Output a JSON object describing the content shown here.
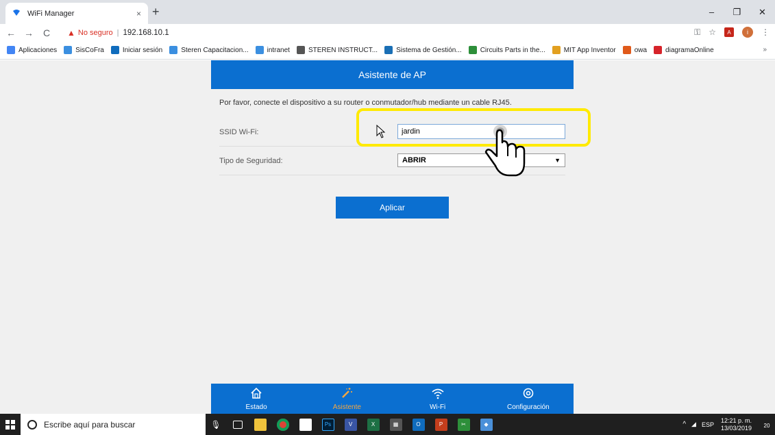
{
  "browser": {
    "tab_title": "WiFi Manager",
    "tab_close": "×",
    "new_tab": "+",
    "window_controls": {
      "minimize": "–",
      "restore": "❐",
      "close": "✕"
    },
    "nav": {
      "back": "←",
      "forward": "→",
      "reload": "C"
    },
    "not_secure": "No seguro",
    "separator": "|",
    "url": "192.168.10.1",
    "bookmarks": [
      {
        "label": "Aplicaciones",
        "icon": "apps-grid-icon",
        "color": "#4285f4"
      },
      {
        "label": "SisCoFra",
        "icon": "steren-icon",
        "color": "#3b8fe0"
      },
      {
        "label": "Iniciar sesión",
        "icon": "outlook-icon",
        "color": "#0f6cbd"
      },
      {
        "label": "Steren Capacitacion...",
        "icon": "steren-icon",
        "color": "#3b8fe0"
      },
      {
        "label": "intranet",
        "icon": "steren-icon",
        "color": "#3b8fe0"
      },
      {
        "label": "STEREN INSTRUCT...",
        "icon": "steren-icon",
        "color": "#555555"
      },
      {
        "label": "Sistema de Gestión...",
        "icon": "sharepoint-icon",
        "color": "#1a6fb5"
      },
      {
        "label": "Circuits Parts in the...",
        "icon": "circuits-icon",
        "color": "#2d8f3a"
      },
      {
        "label": "MIT App Inventor",
        "icon": "mit-icon",
        "color": "#e2a020"
      },
      {
        "label": "owa",
        "icon": "office-icon",
        "color": "#e05a1a"
      },
      {
        "label": "diagramaOnline",
        "icon": "diagrama-icon",
        "color": "#d6232a"
      }
    ],
    "bookmarks_more": "»"
  },
  "page": {
    "header_title": "Asistente de AP",
    "instruction": "Por favor, conecte el dispositivo a su router o conmutador/hub mediante un cable RJ45.",
    "ssid_label": "SSID Wi-Fi:",
    "ssid_value": "jardin",
    "security_label": "Tipo de Seguridad:",
    "security_value": "ABRIR",
    "apply_label": "Aplicar",
    "bottom_nav": [
      {
        "label": "Estado",
        "icon": "home-icon",
        "active": false
      },
      {
        "label": "Asistente",
        "icon": "magic-wand-icon",
        "active": true
      },
      {
        "label": "Wi-Fi",
        "icon": "wifi-icon",
        "active": false
      },
      {
        "label": "Configuración",
        "icon": "gear-icon",
        "active": false
      }
    ],
    "colors": {
      "accent": "#0b6fd0",
      "active_nav": "#f4a742",
      "highlight": "#ffea00"
    }
  },
  "taskbar": {
    "search_placeholder": "Escribe aquí para buscar",
    "language": "ESP",
    "time": "12:21 p. m.",
    "date": "13/03/2019",
    "notification_count": "20"
  }
}
